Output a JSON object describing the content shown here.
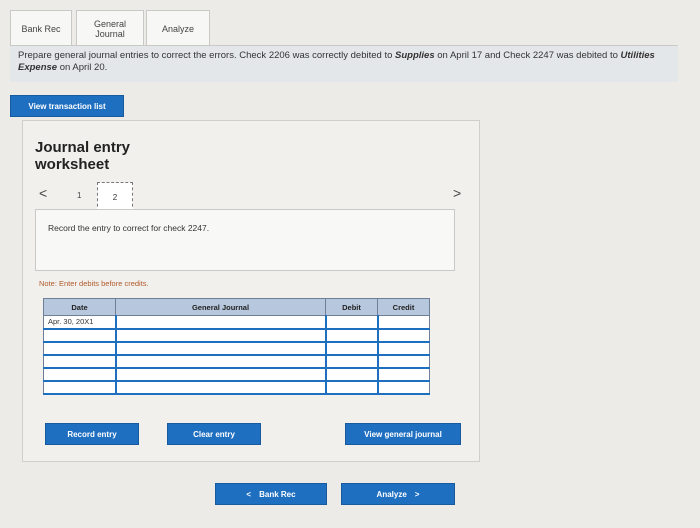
{
  "tabs": [
    {
      "label_line1": "Bank Rec",
      "label_line2": ""
    },
    {
      "label_line1": "General",
      "label_line2": "Journal"
    },
    {
      "label_line1": "Analyze",
      "label_line2": ""
    }
  ],
  "instructions": {
    "text_1": "Prepare general journal entries to correct the errors. Check 2206 was correctly debited to ",
    "supplies": "Supplies",
    "text_2": " on April 17 and Check 2247 was debited to ",
    "utilities": "Utilities Expense",
    "text_3": " on April 20."
  },
  "view_transaction_list": "View transaction list",
  "worksheet": {
    "title_line1": "Journal entry",
    "title_line2": "worksheet",
    "pager": {
      "prev": "<",
      "next": ">",
      "page1": "1",
      "page2": "2"
    },
    "prompt": "Record the entry to correct for check 2247.",
    "note": "Note: Enter debits before credits.",
    "table": {
      "headers": [
        "Date",
        "General Journal",
        "Debit",
        "Credit"
      ],
      "rows": [
        {
          "date": "Apr. 30, 20X1",
          "account": "",
          "debit": "",
          "credit": ""
        },
        {
          "date": "",
          "account": "",
          "debit": "",
          "credit": ""
        },
        {
          "date": "",
          "account": "",
          "debit": "",
          "credit": ""
        },
        {
          "date": "",
          "account": "",
          "debit": "",
          "credit": ""
        },
        {
          "date": "",
          "account": "",
          "debit": "",
          "credit": ""
        },
        {
          "date": "",
          "account": "",
          "debit": "",
          "credit": ""
        }
      ]
    },
    "record_entry": "Record entry",
    "clear_entry": "Clear entry",
    "view_general_journal": "View general journal"
  },
  "bottom_nav": {
    "prev_label": "Bank Rec",
    "prev_icon": "<",
    "next_label": "Analyze",
    "next_icon": ">"
  },
  "colors": {
    "accent": "#1f6fc1",
    "header": "#b7c7dd",
    "note": "#b05a2a"
  }
}
